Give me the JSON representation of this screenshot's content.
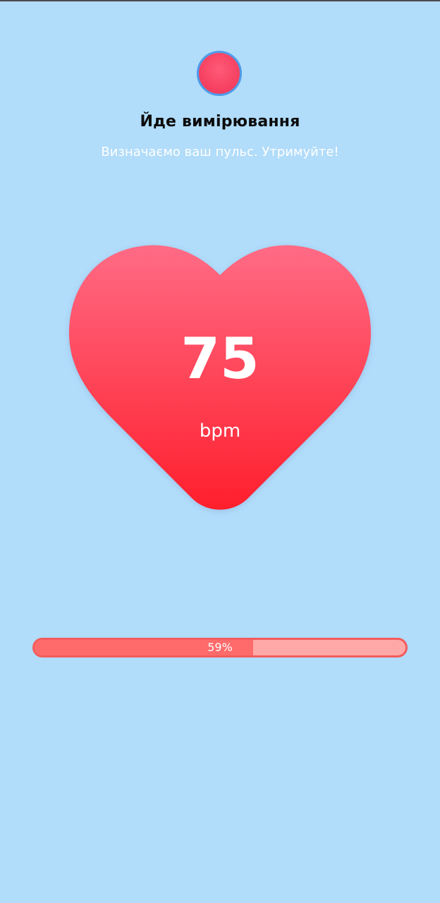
{
  "header": {
    "title": "Йде вимірювання",
    "subtitle": "Визначаємо ваш пульс. Утримуйте!"
  },
  "status_indicator": {
    "color": "#f53e5f",
    "ring_color": "#4e9be8"
  },
  "heart": {
    "value": "75",
    "unit": "bpm",
    "gradient_top": "#ff6b85",
    "gradient_bottom": "#ff1f2d"
  },
  "progress": {
    "percent": 59,
    "label": "59%",
    "fill_color": "#ff6b6b",
    "track_color": "#ffa8a8"
  },
  "colors": {
    "background": "#b1dcfa"
  }
}
